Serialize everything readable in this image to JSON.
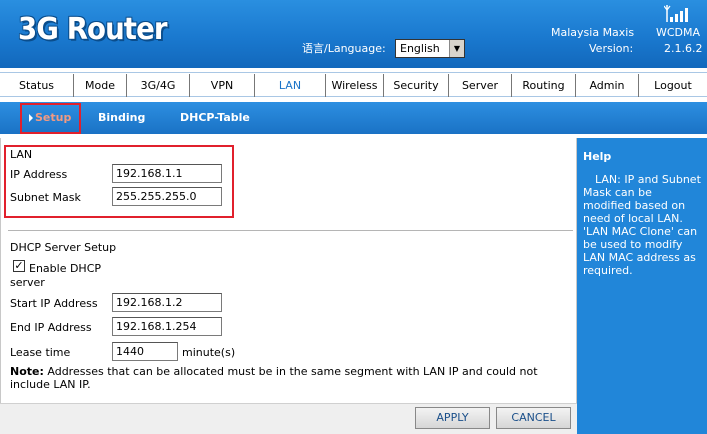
{
  "header": {
    "logo_text": "3G Router",
    "lang_label": "语言/Language:",
    "lang_value": "English",
    "carrier": "Malaysia Maxis",
    "network_type": "WCDMA",
    "version_label": "Version:",
    "version_value": "2.1.6.2"
  },
  "mainnav": [
    {
      "label": "Status",
      "w": 60
    },
    {
      "label": "Mode",
      "w": 60
    },
    {
      "label": "3G/4G",
      "w": 70
    },
    {
      "label": "VPN",
      "w": 60
    },
    {
      "label": "LAN",
      "w": 69
    },
    {
      "label": "Wireless",
      "w": 61
    },
    {
      "label": "Security",
      "w": 66
    },
    {
      "label": "Server",
      "w": 63
    },
    {
      "label": "Routing",
      "w": 63
    },
    {
      "label": "Admin",
      "w": 65
    },
    {
      "label": "Logout",
      "w": 70
    }
  ],
  "subnav": {
    "setup": "Setup",
    "binding": "Binding",
    "dhcp_table": "DHCP-Table"
  },
  "lan": {
    "title": "LAN",
    "ip_label": "IP Address",
    "ip_value": "192.168.1.1",
    "mask_label": "Subnet Mask",
    "mask_value": "255.255.255.0"
  },
  "dhcp": {
    "title": "DHCP Server Setup",
    "enable_label_1": "Enable DHCP",
    "enable_label_2": "server",
    "enabled": true,
    "start_label": "Start IP Address",
    "start_value": "192.168.1.2",
    "end_label": "End IP Address",
    "end_value": "192.168.1.254",
    "lease_label": "Lease time",
    "lease_value": "1440",
    "lease_unit": "minute(s)"
  },
  "note": {
    "prefix": "Note:",
    "text": " Addresses that can be allocated must be in the same segment with LAN IP and could not include LAN IP."
  },
  "buttons": {
    "apply": "APPLY",
    "cancel": "CANCEL"
  },
  "help": {
    "title": "Help",
    "text": "LAN: IP and Subnet Mask can be modified based on need of local LAN. 'LAN MAC Clone' can be used to modify LAN MAC address as required."
  }
}
